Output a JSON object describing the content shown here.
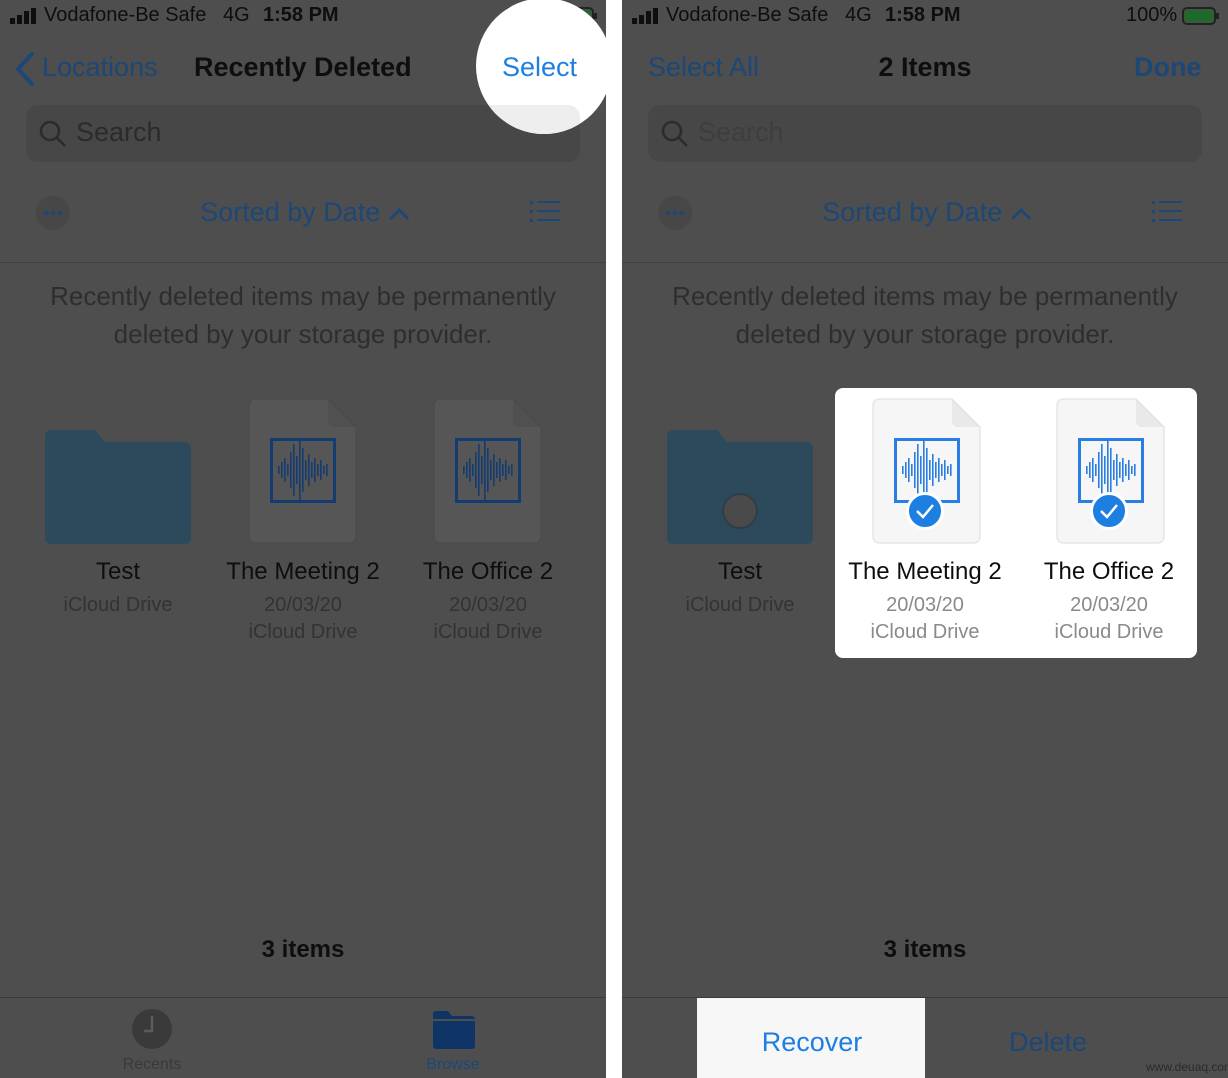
{
  "status": {
    "carrier": "Vodafone-Be Safe",
    "network": "4G",
    "time": "1:58 PM",
    "battery": "100%"
  },
  "left": {
    "nav": {
      "back_label": "Locations",
      "title": "Recently Deleted",
      "select_label": "Select"
    },
    "search_placeholder": "Search",
    "sort_label": "Sorted by Date",
    "info": [
      "Recently deleted items may be permanently",
      "deleted by your storage provider."
    ],
    "items": [
      {
        "name": "Test",
        "date": "",
        "location": "iCloud Drive",
        "type": "folder"
      },
      {
        "name": "The Meeting 2",
        "date": "20/03/20",
        "location": "iCloud Drive",
        "type": "audio"
      },
      {
        "name": "The Office 2",
        "date": "20/03/20",
        "location": "iCloud Drive",
        "type": "audio"
      }
    ],
    "count": "3 items",
    "tabs": [
      {
        "label": "Recents",
        "icon": "clock-icon"
      },
      {
        "label": "Browse",
        "icon": "folder-icon",
        "active": true
      }
    ]
  },
  "right": {
    "nav": {
      "select_all_label": "Select All",
      "title": "2 Items",
      "done_label": "Done"
    },
    "search_placeholder": "Search",
    "sort_label": "Sorted by Date",
    "info": [
      "Recently deleted items may be permanently",
      "deleted by your storage provider."
    ],
    "items": [
      {
        "name": "Test",
        "date": "",
        "location": "iCloud Drive",
        "selected": false
      },
      {
        "name": "The Meeting 2",
        "date": "20/03/20",
        "location": "iCloud Drive",
        "selected": true
      },
      {
        "name": "The Office 2",
        "date": "20/03/20",
        "location": "iCloud Drive",
        "selected": true
      }
    ],
    "count": "3 items",
    "toolbar": {
      "recover_label": "Recover",
      "delete_label": "Delete"
    }
  },
  "colors": {
    "accent": "#1e7fe3",
    "dim_overlay": "#4e4e4e",
    "folder": "#2c4a5c"
  },
  "watermark": "www.deuaq.com"
}
